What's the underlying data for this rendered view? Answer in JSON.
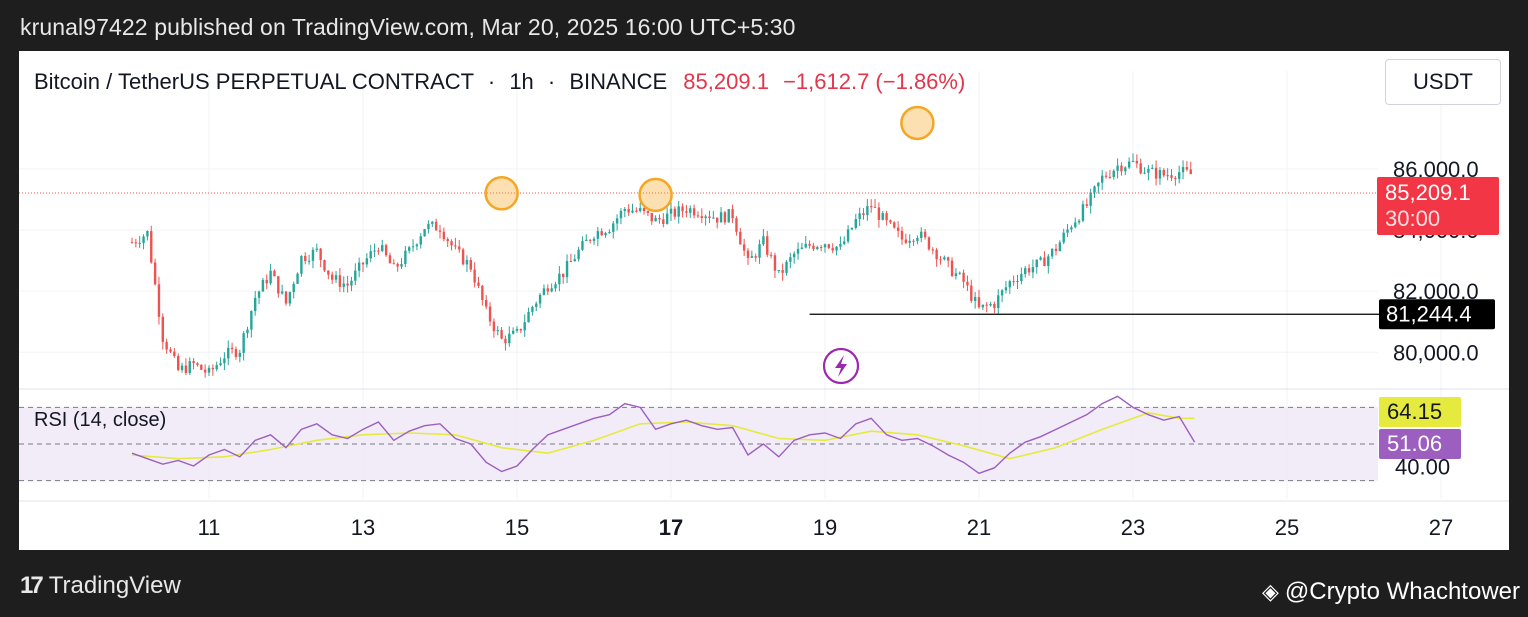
{
  "header": {
    "published": "krunal97422 published on TradingView.com, Mar 20, 2025 16:00 UTC+5:30"
  },
  "symbol_bar": {
    "name": "Bitcoin / TetherUS PERPETUAL CONTRACT",
    "interval": "1h",
    "exchange": "BINANCE",
    "last": "85,209.1",
    "change": "−1,612.7 (−1.86%)",
    "currency": "USDT"
  },
  "price_labels": {
    "current": "85,209.1",
    "countdown": "30:00",
    "support": "81,244.4"
  },
  "rsi": {
    "label": "RSI (14, close)",
    "value_ma": "64.15",
    "value_rsi": "51.06"
  },
  "footer": {
    "brand": "TradingView",
    "credit": "@Crypto Whachtower"
  },
  "colors": {
    "up": "#26a69a",
    "down": "#ef5350",
    "rsi_line": "#9c5fc0",
    "rsi_ma": "#e6ea3e",
    "current_price_bg": "#f23645",
    "support_bg": "#000000",
    "marker": "#f5a623"
  },
  "chart_data": {
    "type": "candlestick",
    "symbol": "BTCUSDT.P",
    "interval": "1h",
    "price_axis": {
      "ticks": [
        80000,
        82000,
        84000,
        86000
      ],
      "tick_labels": [
        "80,000.0",
        "82,000.0",
        "84,000.0",
        "86,000.0"
      ],
      "range": [
        78800,
        89200
      ]
    },
    "x_axis": {
      "ticks": [
        "11",
        "13",
        "15",
        "17",
        "19",
        "21",
        "23",
        "25",
        "27"
      ],
      "bold": "17"
    },
    "horizontal_lines": [
      {
        "price": 85209.1,
        "style": "dotted",
        "label": "85,209.1"
      },
      {
        "price": 81244.4,
        "style": "solid",
        "label": "81,244.4",
        "from_date": 18.8
      }
    ],
    "markers": [
      {
        "date": 14.8,
        "price": 85200
      },
      {
        "date": 16.8,
        "price": 85150
      },
      {
        "date": 20.2,
        "price": 87500
      }
    ],
    "path": [
      [
        10.0,
        83600
      ],
      [
        10.2,
        83900
      ],
      [
        10.4,
        80500
      ],
      [
        10.6,
        79400
      ],
      [
        10.8,
        79600
      ],
      [
        11.0,
        79300
      ],
      [
        11.2,
        79900
      ],
      [
        11.4,
        80100
      ],
      [
        11.6,
        81800
      ],
      [
        11.8,
        82600
      ],
      [
        12.0,
        81600
      ],
      [
        12.2,
        83100
      ],
      [
        12.4,
        83300
      ],
      [
        12.6,
        82400
      ],
      [
        12.8,
        82200
      ],
      [
        13.0,
        82900
      ],
      [
        13.2,
        83500
      ],
      [
        13.4,
        82700
      ],
      [
        13.6,
        83300
      ],
      [
        13.8,
        84100
      ],
      [
        14.0,
        84100
      ],
      [
        14.2,
        83300
      ],
      [
        14.4,
        82800
      ],
      [
        14.6,
        81300
      ],
      [
        14.8,
        80400
      ],
      [
        15.0,
        80600
      ],
      [
        15.2,
        81500
      ],
      [
        15.4,
        82200
      ],
      [
        15.6,
        82600
      ],
      [
        15.8,
        83300
      ],
      [
        16.0,
        83900
      ],
      [
        16.2,
        84100
      ],
      [
        16.4,
        84700
      ],
      [
        16.6,
        84600
      ],
      [
        16.8,
        84300
      ],
      [
        17.0,
        84500
      ],
      [
        17.2,
        84700
      ],
      [
        17.4,
        84600
      ],
      [
        17.6,
        84400
      ],
      [
        17.8,
        84500
      ],
      [
        18.0,
        82900
      ],
      [
        18.2,
        83600
      ],
      [
        18.4,
        82500
      ],
      [
        18.6,
        83200
      ],
      [
        18.8,
        83500
      ],
      [
        19.0,
        83600
      ],
      [
        19.2,
        83400
      ],
      [
        19.4,
        84300
      ],
      [
        19.6,
        84800
      ],
      [
        19.8,
        84200
      ],
      [
        20.0,
        83700
      ],
      [
        20.2,
        83900
      ],
      [
        20.4,
        83400
      ],
      [
        20.6,
        82800
      ],
      [
        20.8,
        82300
      ],
      [
        21.0,
        81400
      ],
      [
        21.2,
        81600
      ],
      [
        21.4,
        82300
      ],
      [
        21.6,
        82700
      ],
      [
        21.8,
        82900
      ],
      [
        22.0,
        83400
      ],
      [
        22.2,
        84200
      ],
      [
        22.4,
        84800
      ],
      [
        22.6,
        85700
      ],
      [
        22.8,
        86100
      ],
      [
        23.0,
        86200
      ],
      [
        23.2,
        85900
      ],
      [
        23.4,
        85800
      ],
      [
        23.6,
        85900
      ],
      [
        23.8,
        85800
      ]
    ],
    "rsi": {
      "range": [
        20,
        80
      ],
      "bands": [
        30,
        50,
        70
      ],
      "band_labels": [
        "40.00"
      ],
      "rsi_path": [
        [
          10.0,
          45
        ],
        [
          10.2,
          42
        ],
        [
          10.4,
          39
        ],
        [
          10.6,
          41
        ],
        [
          10.8,
          38
        ],
        [
          11.0,
          44
        ],
        [
          11.2,
          47
        ],
        [
          11.4,
          43
        ],
        [
          11.6,
          52
        ],
        [
          11.8,
          55
        ],
        [
          12.0,
          48
        ],
        [
          12.2,
          58
        ],
        [
          12.4,
          61
        ],
        [
          12.6,
          55
        ],
        [
          12.8,
          53
        ],
        [
          13.0,
          58
        ],
        [
          13.2,
          62
        ],
        [
          13.4,
          52
        ],
        [
          13.6,
          57
        ],
        [
          13.8,
          60
        ],
        [
          14.0,
          61
        ],
        [
          14.2,
          53
        ],
        [
          14.4,
          50
        ],
        [
          14.6,
          40
        ],
        [
          14.8,
          35
        ],
        [
          15.0,
          38
        ],
        [
          15.2,
          47
        ],
        [
          15.4,
          55
        ],
        [
          15.6,
          58
        ],
        [
          15.8,
          61
        ],
        [
          16.0,
          64
        ],
        [
          16.2,
          66
        ],
        [
          16.4,
          72
        ],
        [
          16.6,
          70
        ],
        [
          16.8,
          58
        ],
        [
          17.0,
          61
        ],
        [
          17.2,
          63
        ],
        [
          17.4,
          60
        ],
        [
          17.6,
          58
        ],
        [
          17.8,
          59
        ],
        [
          18.0,
          44
        ],
        [
          18.2,
          50
        ],
        [
          18.4,
          43
        ],
        [
          18.6,
          52
        ],
        [
          18.8,
          55
        ],
        [
          19.0,
          56
        ],
        [
          19.2,
          53
        ],
        [
          19.4,
          61
        ],
        [
          19.6,
          64
        ],
        [
          19.8,
          55
        ],
        [
          20.0,
          52
        ],
        [
          20.2,
          53
        ],
        [
          20.4,
          49
        ],
        [
          20.6,
          44
        ],
        [
          20.8,
          40
        ],
        [
          21.0,
          34
        ],
        [
          21.2,
          37
        ],
        [
          21.4,
          45
        ],
        [
          21.6,
          51
        ],
        [
          21.8,
          54
        ],
        [
          22.0,
          58
        ],
        [
          22.2,
          62
        ],
        [
          22.4,
          66
        ],
        [
          22.6,
          72
        ],
        [
          22.8,
          76
        ],
        [
          23.0,
          70
        ],
        [
          23.2,
          66
        ],
        [
          23.4,
          63
        ],
        [
          23.6,
          65
        ],
        [
          23.8,
          51
        ]
      ],
      "ma_path": [
        [
          10.0,
          44
        ],
        [
          10.6,
          42
        ],
        [
          11.2,
          43
        ],
        [
          11.8,
          47
        ],
        [
          12.4,
          52
        ],
        [
          13.0,
          55
        ],
        [
          13.6,
          56
        ],
        [
          14.2,
          55
        ],
        [
          14.8,
          48
        ],
        [
          15.4,
          45
        ],
        [
          16.0,
          52
        ],
        [
          16.6,
          61
        ],
        [
          17.2,
          62
        ],
        [
          17.8,
          60
        ],
        [
          18.4,
          53
        ],
        [
          19.0,
          52
        ],
        [
          19.6,
          57
        ],
        [
          20.2,
          55
        ],
        [
          20.8,
          49
        ],
        [
          21.4,
          42
        ],
        [
          22.0,
          48
        ],
        [
          22.6,
          58
        ],
        [
          23.2,
          67
        ],
        [
          23.6,
          64
        ],
        [
          23.8,
          64
        ]
      ]
    }
  }
}
